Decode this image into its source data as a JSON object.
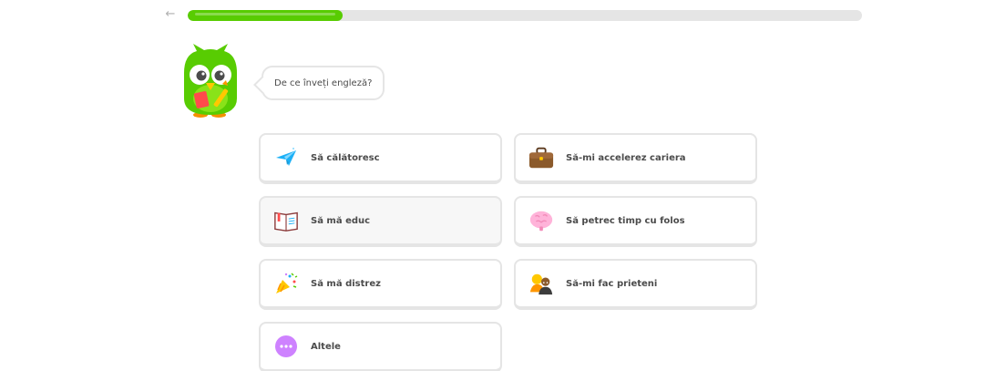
{
  "header": {
    "back_icon": "arrow-left-icon",
    "progress": 0.23,
    "progress_color": "#58cc02",
    "track_color": "#e5e5e5"
  },
  "prompt": {
    "mascot_icon": "owl-mascot-icon",
    "question": "De ce înveți engleză?"
  },
  "options": [
    {
      "label": "Să călătoresc",
      "icon": "airplane-icon"
    },
    {
      "label": "Să-mi accelerez cariera",
      "icon": "briefcase-icon"
    },
    {
      "label": "Să mă educ",
      "icon": "book-icon",
      "hovered": true
    },
    {
      "label": "Să petrec timp cu folos",
      "icon": "brain-icon"
    },
    {
      "label": "Să mă distrez",
      "icon": "party-popper-icon"
    },
    {
      "label": "Să-mi fac prieteni",
      "icon": "friends-icon"
    },
    {
      "label": "Altele",
      "icon": "more-icon"
    }
  ],
  "colors": {
    "accent": "#58cc02",
    "border": "#e5e5e5",
    "text": "#4b4b4b"
  }
}
